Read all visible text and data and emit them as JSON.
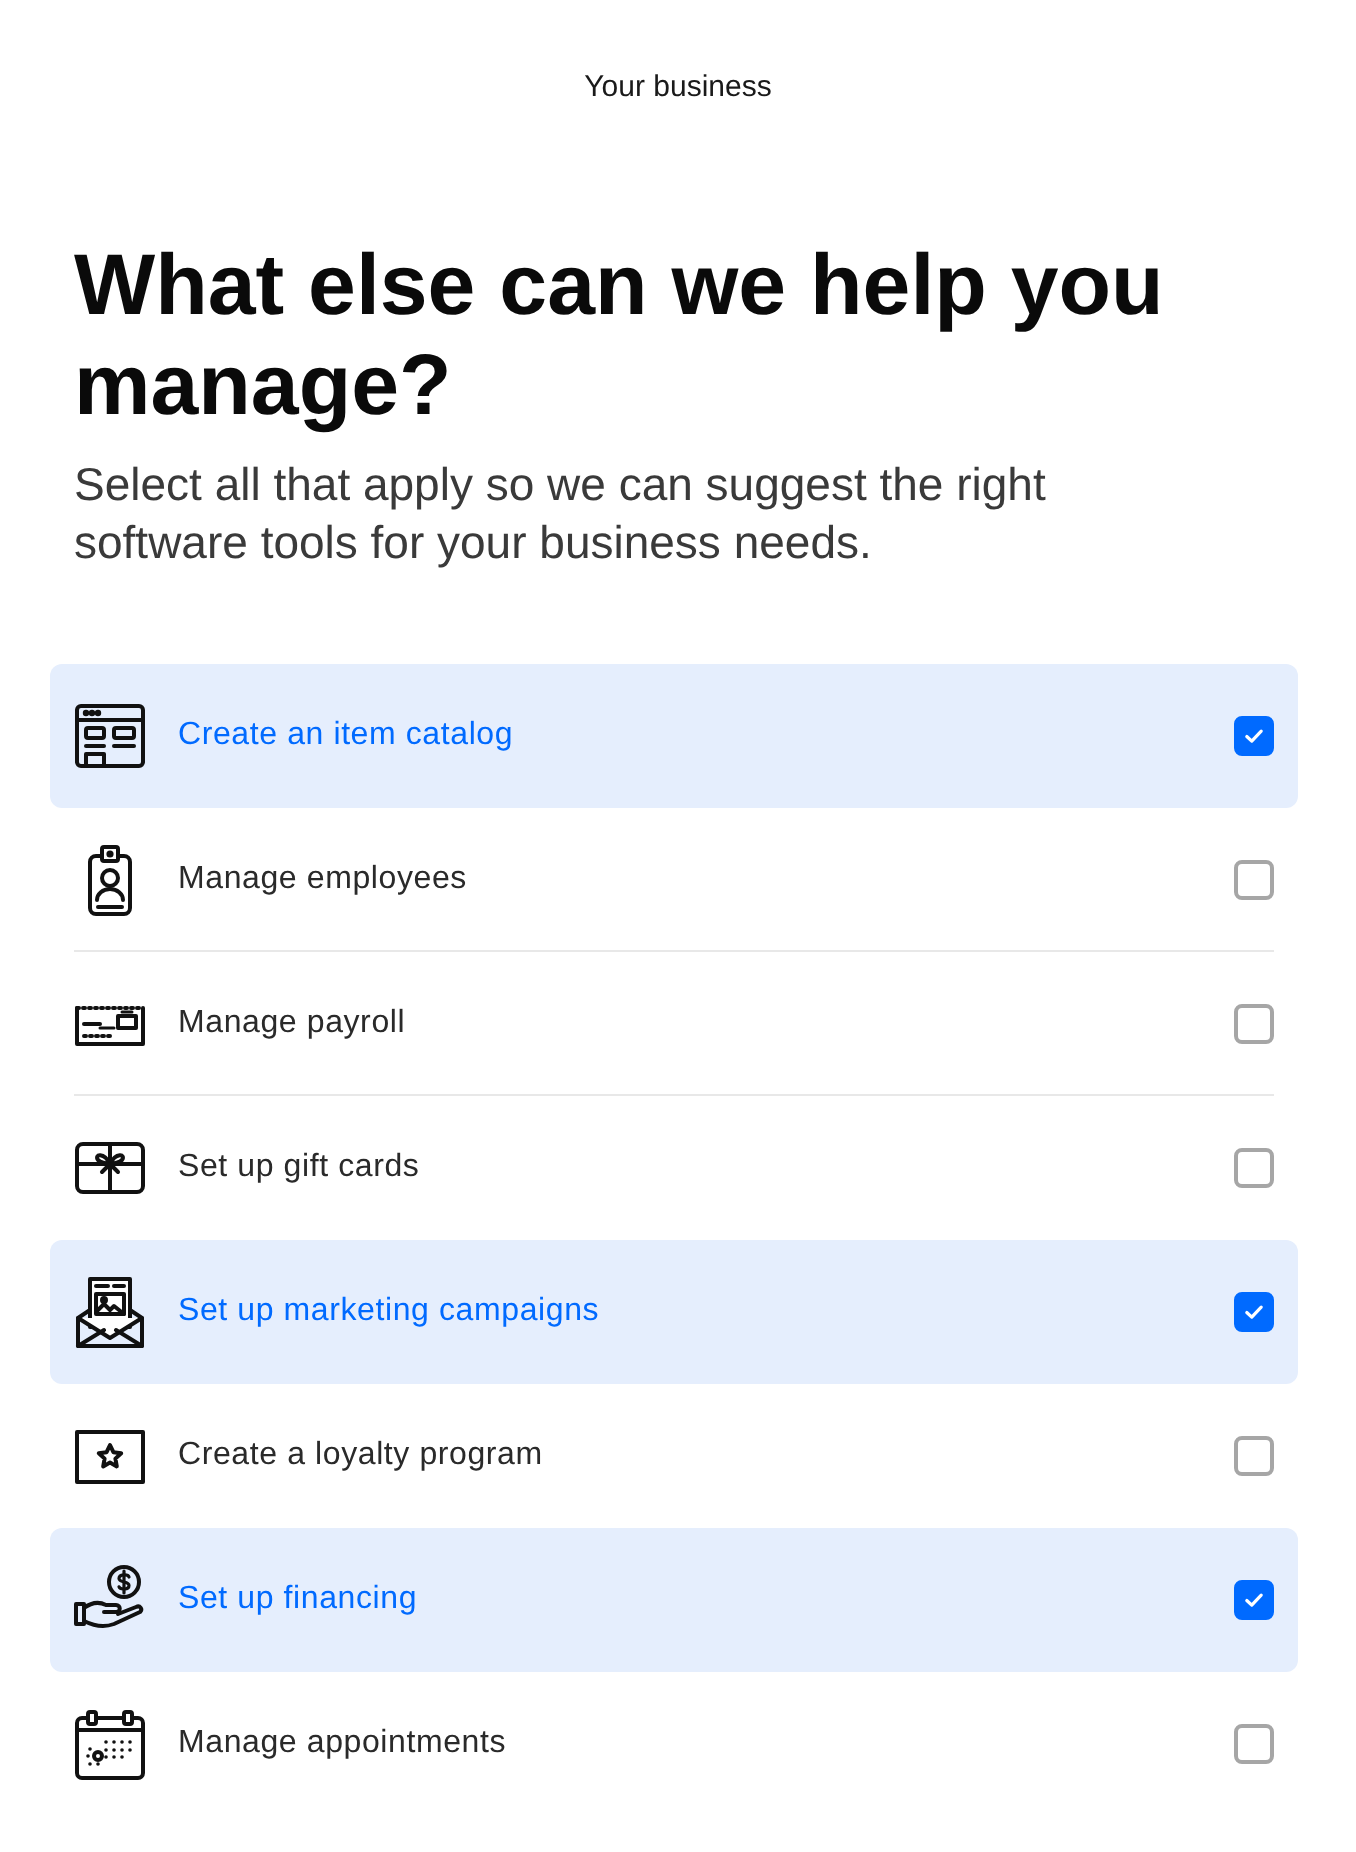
{
  "header": {
    "title": "Your business"
  },
  "heading": "What else can we help you manage?",
  "subtitle": "Select all that apply so we can suggest the right software tools for your business needs.",
  "options": [
    {
      "label": "Create an item catalog",
      "selected": true
    },
    {
      "label": "Manage employees",
      "selected": false
    },
    {
      "label": "Manage payroll",
      "selected": false
    },
    {
      "label": "Set up gift cards",
      "selected": false
    },
    {
      "label": "Set up marketing campaigns",
      "selected": true
    },
    {
      "label": "Create a loyalty program",
      "selected": false
    },
    {
      "label": "Set up financing",
      "selected": true
    },
    {
      "label": "Manage appointments",
      "selected": false
    }
  ]
}
